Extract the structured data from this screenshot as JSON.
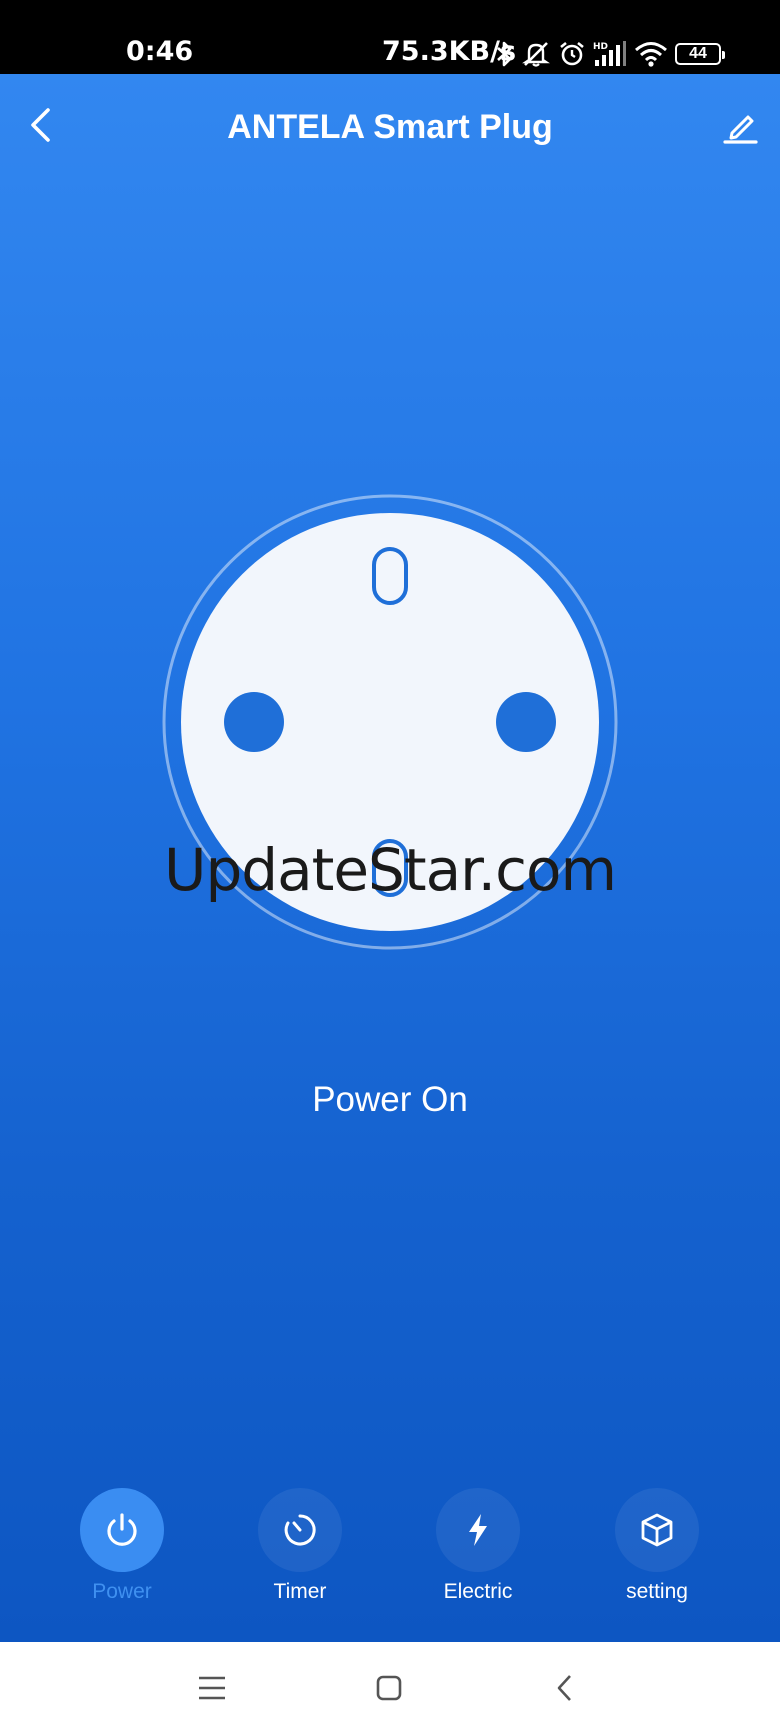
{
  "status_bar": {
    "time": "0:46",
    "network_speed": "75.3KB/s",
    "battery_level": "44",
    "icons": [
      "bluetooth-icon",
      "mute-icon",
      "alarm-icon",
      "hd-signal-icon",
      "wifi-icon",
      "battery-icon"
    ]
  },
  "header": {
    "title": "ANTELA Smart Plug",
    "back_icon": "chevron-left-icon",
    "edit_icon": "pencil-icon"
  },
  "device": {
    "status_text": "Power On",
    "watermark": "UpdateStar.com"
  },
  "tabs": [
    {
      "label": "Power",
      "icon": "power-icon",
      "active": true
    },
    {
      "label": "Timer",
      "icon": "timer-icon",
      "active": false
    },
    {
      "label": "Electric",
      "icon": "lightning-icon",
      "active": false
    },
    {
      "label": "setting",
      "icon": "cube-icon",
      "active": false
    }
  ],
  "colors": {
    "accent": "#3a8df2",
    "background_top": "#3287f0",
    "background_bottom": "#0d56c2",
    "socket_face": "#f2f6fc",
    "socket_hole": "#1f6fd8"
  },
  "nav_bar": {
    "icons": [
      "menu-icon",
      "home-icon",
      "back-icon"
    ]
  }
}
